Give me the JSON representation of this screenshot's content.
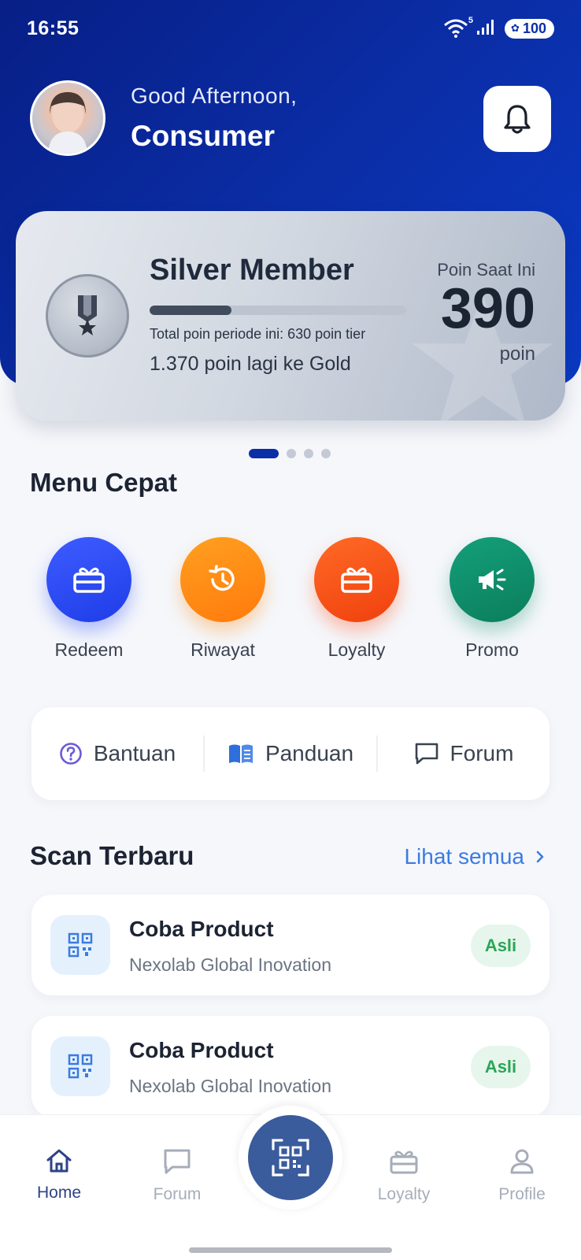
{
  "status_bar": {
    "time": "16:55",
    "wifi_badge": "5",
    "battery": "100"
  },
  "header": {
    "greeting": "Good Afternoon,",
    "user_name": "Consumer"
  },
  "member_card": {
    "tier": "Silver Member",
    "progress_fraction": 0.32,
    "period_text": "Total poin periode ini: 630 poin tier",
    "next_tier_text": "1.370 poin lagi ke Gold",
    "points_label": "Poin Saat Ini",
    "points_value": "390",
    "points_unit": "poin"
  },
  "carousel": {
    "count": 4,
    "active_index": 0
  },
  "quick_menu": {
    "title": "Menu Cepat",
    "items": [
      {
        "label": "Redeem",
        "icon": "gift-icon",
        "color": "#2f4ef5"
      },
      {
        "label": "Riwayat",
        "icon": "history-icon",
        "color": "#ff8a12"
      },
      {
        "label": "Loyalty",
        "icon": "gift-icon",
        "color": "#ff4f1a"
      },
      {
        "label": "Promo",
        "icon": "megaphone-icon",
        "color": "#0f8c68"
      }
    ]
  },
  "help_links": [
    {
      "label": "Bantuan",
      "icon": "question-circle-icon"
    },
    {
      "label": "Panduan",
      "icon": "book-icon"
    },
    {
      "label": "Forum",
      "icon": "chat-icon"
    }
  ],
  "recent_scans": {
    "title": "Scan Terbaru",
    "see_all": "Lihat semua",
    "items": [
      {
        "title": "Coba Product",
        "subtitle": "Nexolab Global Inovation",
        "badge": "Asli"
      },
      {
        "title": "Coba Product",
        "subtitle": "Nexolab Global Inovation",
        "badge": "Asli"
      }
    ]
  },
  "bottom_nav": {
    "items": [
      {
        "label": "Home",
        "icon": "home-icon",
        "active": true
      },
      {
        "label": "Forum",
        "icon": "chat-icon",
        "active": false
      },
      {
        "label": "Loyalty",
        "icon": "gift-icon",
        "active": false
      },
      {
        "label": "Profile",
        "icon": "user-icon",
        "active": false
      }
    ],
    "center_action_icon": "qr-scan-icon"
  },
  "colors": {
    "primary": "#0b2ea8",
    "accent_link": "#3b7be0",
    "badge_green": "#2ba656"
  }
}
